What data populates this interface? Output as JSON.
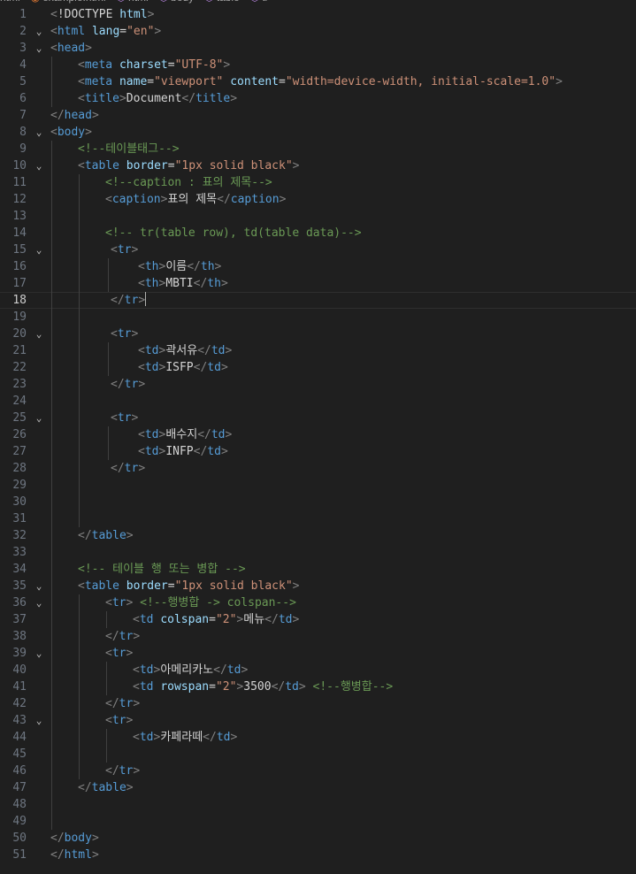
{
  "breadcrumb": [
    {
      "label": "html",
      "icon": ""
    },
    {
      "label": "example.html",
      "icon": "html-file-icon"
    },
    {
      "label": "html",
      "icon": "element-icon"
    },
    {
      "label": "body",
      "icon": "element-icon"
    },
    {
      "label": "table",
      "icon": "element-icon"
    },
    {
      "label": "tr",
      "icon": "element-icon"
    }
  ],
  "editor": {
    "current_line": 18,
    "colors": {
      "background": "#1f1f1f",
      "bracket": "#808080",
      "tag": "#569cd6",
      "attribute": "#9cdcfe",
      "string": "#ce9178",
      "comment": "#6a9955",
      "text": "#d4d4d4",
      "line_number": "#6e7681"
    },
    "lines": [
      {
        "n": "1",
        "fold": false,
        "indent": 0,
        "tokens": [
          [
            "b",
            "<"
          ],
          [
            "x",
            "!DOCTYPE "
          ],
          [
            "a",
            "html"
          ],
          [
            "b",
            ">"
          ]
        ]
      },
      {
        "n": "2",
        "fold": true,
        "indent": 0,
        "tokens": [
          [
            "b",
            "<"
          ],
          [
            "t",
            "html "
          ],
          [
            "a",
            "lang"
          ],
          [
            "x",
            "="
          ],
          [
            "s",
            "\"en\""
          ],
          [
            "b",
            ">"
          ]
        ]
      },
      {
        "n": "3",
        "fold": true,
        "indent": 0,
        "tokens": [
          [
            "b",
            "<"
          ],
          [
            "t",
            "head"
          ],
          [
            "b",
            ">"
          ]
        ]
      },
      {
        "n": "4",
        "fold": false,
        "indent": 1,
        "tokens": [
          [
            "b",
            "<"
          ],
          [
            "t",
            "meta "
          ],
          [
            "a",
            "charset"
          ],
          [
            "x",
            "="
          ],
          [
            "s",
            "\"UTF-8\""
          ],
          [
            "b",
            ">"
          ]
        ]
      },
      {
        "n": "5",
        "fold": false,
        "indent": 1,
        "tokens": [
          [
            "b",
            "<"
          ],
          [
            "t",
            "meta "
          ],
          [
            "a",
            "name"
          ],
          [
            "x",
            "="
          ],
          [
            "s",
            "\"viewport\""
          ],
          [
            "x",
            " "
          ],
          [
            "a",
            "content"
          ],
          [
            "x",
            "="
          ],
          [
            "s",
            "\"width=device-width, initial-scale=1.0\""
          ],
          [
            "b",
            ">"
          ]
        ]
      },
      {
        "n": "6",
        "fold": false,
        "indent": 1,
        "tokens": [
          [
            "b",
            "<"
          ],
          [
            "t",
            "title"
          ],
          [
            "b",
            ">"
          ],
          [
            "x",
            "Document"
          ],
          [
            "b",
            "</"
          ],
          [
            "t",
            "title"
          ],
          [
            "b",
            ">"
          ]
        ]
      },
      {
        "n": "7",
        "fold": false,
        "indent": 0,
        "tokens": [
          [
            "b",
            "</"
          ],
          [
            "t",
            "head"
          ],
          [
            "b",
            ">"
          ]
        ]
      },
      {
        "n": "8",
        "fold": true,
        "indent": 0,
        "tokens": [
          [
            "b",
            "<"
          ],
          [
            "t",
            "body"
          ],
          [
            "b",
            ">"
          ]
        ]
      },
      {
        "n": "9",
        "fold": false,
        "indent": 1,
        "tokens": [
          [
            "c",
            "<!--테이블태그-->"
          ]
        ]
      },
      {
        "n": "10",
        "fold": true,
        "indent": 1,
        "tokens": [
          [
            "b",
            "<"
          ],
          [
            "t",
            "table "
          ],
          [
            "a",
            "border"
          ],
          [
            "x",
            "="
          ],
          [
            "s",
            "\"1px solid black\""
          ],
          [
            "b",
            ">"
          ]
        ]
      },
      {
        "n": "11",
        "fold": false,
        "indent": 2,
        "tokens": [
          [
            "c",
            "<!--caption : 표의 제목-->"
          ]
        ]
      },
      {
        "n": "12",
        "fold": false,
        "indent": 2,
        "tokens": [
          [
            "b",
            "<"
          ],
          [
            "t",
            "caption"
          ],
          [
            "b",
            ">"
          ],
          [
            "x",
            "표의 제목"
          ],
          [
            "b",
            "</"
          ],
          [
            "t",
            "caption"
          ],
          [
            "b",
            ">"
          ]
        ]
      },
      {
        "n": "13",
        "fold": false,
        "indent": 2,
        "tokens": []
      },
      {
        "n": "14",
        "fold": false,
        "indent": 2,
        "tokens": [
          [
            "c",
            "<!-- tr(table row), td(table data)-->"
          ]
        ]
      },
      {
        "n": "15",
        "fold": true,
        "indent": 2,
        "extra": 2,
        "tokens": [
          [
            "b",
            "<"
          ],
          [
            "t",
            "tr"
          ],
          [
            "b",
            ">"
          ]
        ]
      },
      {
        "n": "16",
        "fold": false,
        "indent": 3,
        "extra": 2,
        "tokens": [
          [
            "b",
            "<"
          ],
          [
            "t",
            "th"
          ],
          [
            "b",
            ">"
          ],
          [
            "x",
            "이름"
          ],
          [
            "b",
            "</"
          ],
          [
            "t",
            "th"
          ],
          [
            "b",
            ">"
          ]
        ]
      },
      {
        "n": "17",
        "fold": false,
        "indent": 3,
        "extra": 2,
        "tokens": [
          [
            "b",
            "<"
          ],
          [
            "t",
            "th"
          ],
          [
            "b",
            ">"
          ],
          [
            "x",
            "MBTI"
          ],
          [
            "b",
            "</"
          ],
          [
            "t",
            "th"
          ],
          [
            "b",
            ">"
          ]
        ]
      },
      {
        "n": "18",
        "fold": false,
        "indent": 2,
        "extra": 2,
        "cursor": true,
        "tokens": [
          [
            "b",
            "</"
          ],
          [
            "t",
            "tr"
          ],
          [
            "b",
            ">"
          ]
        ]
      },
      {
        "n": "19",
        "fold": false,
        "indent": 2,
        "tokens": []
      },
      {
        "n": "20",
        "fold": true,
        "indent": 2,
        "extra": 2,
        "tokens": [
          [
            "b",
            "<"
          ],
          [
            "t",
            "tr"
          ],
          [
            "b",
            ">"
          ]
        ]
      },
      {
        "n": "21",
        "fold": false,
        "indent": 3,
        "extra": 2,
        "tokens": [
          [
            "b",
            "<"
          ],
          [
            "t",
            "td"
          ],
          [
            "b",
            ">"
          ],
          [
            "x",
            "곽서유"
          ],
          [
            "b",
            "</"
          ],
          [
            "t",
            "td"
          ],
          [
            "b",
            ">"
          ]
        ]
      },
      {
        "n": "22",
        "fold": false,
        "indent": 3,
        "extra": 2,
        "tokens": [
          [
            "b",
            "<"
          ],
          [
            "t",
            "td"
          ],
          [
            "b",
            ">"
          ],
          [
            "x",
            "ISFP"
          ],
          [
            "b",
            "</"
          ],
          [
            "t",
            "td"
          ],
          [
            "b",
            ">"
          ]
        ]
      },
      {
        "n": "23",
        "fold": false,
        "indent": 2,
        "extra": 2,
        "tokens": [
          [
            "b",
            "</"
          ],
          [
            "t",
            "tr"
          ],
          [
            "b",
            ">"
          ]
        ]
      },
      {
        "n": "24",
        "fold": false,
        "indent": 2,
        "tokens": []
      },
      {
        "n": "25",
        "fold": true,
        "indent": 2,
        "extra": 2,
        "tokens": [
          [
            "b",
            "<"
          ],
          [
            "t",
            "tr"
          ],
          [
            "b",
            ">"
          ]
        ]
      },
      {
        "n": "26",
        "fold": false,
        "indent": 3,
        "extra": 2,
        "tokens": [
          [
            "b",
            "<"
          ],
          [
            "t",
            "td"
          ],
          [
            "b",
            ">"
          ],
          [
            "x",
            "배수지"
          ],
          [
            "b",
            "</"
          ],
          [
            "t",
            "td"
          ],
          [
            "b",
            ">"
          ]
        ]
      },
      {
        "n": "27",
        "fold": false,
        "indent": 3,
        "extra": 2,
        "tokens": [
          [
            "b",
            "<"
          ],
          [
            "t",
            "td"
          ],
          [
            "b",
            ">"
          ],
          [
            "x",
            "INFP"
          ],
          [
            "b",
            "</"
          ],
          [
            "t",
            "td"
          ],
          [
            "b",
            ">"
          ]
        ]
      },
      {
        "n": "28",
        "fold": false,
        "indent": 2,
        "extra": 2,
        "tokens": [
          [
            "b",
            "</"
          ],
          [
            "t",
            "tr"
          ],
          [
            "b",
            ">"
          ]
        ]
      },
      {
        "n": "29",
        "fold": false,
        "indent": 2,
        "tokens": []
      },
      {
        "n": "30",
        "fold": false,
        "indent": 2,
        "tokens": []
      },
      {
        "n": "31",
        "fold": false,
        "indent": 2,
        "tokens": []
      },
      {
        "n": "32",
        "fold": false,
        "indent": 1,
        "tokens": [
          [
            "b",
            "</"
          ],
          [
            "t",
            "table"
          ],
          [
            "b",
            ">"
          ]
        ]
      },
      {
        "n": "33",
        "fold": false,
        "indent": 1,
        "tokens": []
      },
      {
        "n": "34",
        "fold": false,
        "indent": 1,
        "tokens": [
          [
            "c",
            "<!-- 테이블 행 또는 병합 -->"
          ]
        ]
      },
      {
        "n": "35",
        "fold": true,
        "indent": 1,
        "tokens": [
          [
            "b",
            "<"
          ],
          [
            "t",
            "table "
          ],
          [
            "a",
            "border"
          ],
          [
            "x",
            "="
          ],
          [
            "s",
            "\"1px solid black\""
          ],
          [
            "b",
            ">"
          ]
        ]
      },
      {
        "n": "36",
        "fold": true,
        "indent": 2,
        "tokens": [
          [
            "b",
            "<"
          ],
          [
            "t",
            "tr"
          ],
          [
            "b",
            ">"
          ],
          [
            "x",
            " "
          ],
          [
            "c",
            "<!--행병합 -> colspan-->"
          ]
        ]
      },
      {
        "n": "37",
        "fold": false,
        "indent": 3,
        "tokens": [
          [
            "b",
            "<"
          ],
          [
            "t",
            "td "
          ],
          [
            "a",
            "colspan"
          ],
          [
            "x",
            "="
          ],
          [
            "s",
            "\"2\""
          ],
          [
            "b",
            ">"
          ],
          [
            "x",
            "메뉴"
          ],
          [
            "b",
            "</"
          ],
          [
            "t",
            "td"
          ],
          [
            "b",
            ">"
          ]
        ]
      },
      {
        "n": "38",
        "fold": false,
        "indent": 2,
        "tokens": [
          [
            "b",
            "</"
          ],
          [
            "t",
            "tr"
          ],
          [
            "b",
            ">"
          ]
        ]
      },
      {
        "n": "39",
        "fold": true,
        "indent": 2,
        "tokens": [
          [
            "b",
            "<"
          ],
          [
            "t",
            "tr"
          ],
          [
            "b",
            ">"
          ]
        ]
      },
      {
        "n": "40",
        "fold": false,
        "indent": 3,
        "tokens": [
          [
            "b",
            "<"
          ],
          [
            "t",
            "td"
          ],
          [
            "b",
            ">"
          ],
          [
            "x",
            "아메리카노"
          ],
          [
            "b",
            "</"
          ],
          [
            "t",
            "td"
          ],
          [
            "b",
            ">"
          ]
        ]
      },
      {
        "n": "41",
        "fold": false,
        "indent": 3,
        "tokens": [
          [
            "b",
            "<"
          ],
          [
            "t",
            "td "
          ],
          [
            "a",
            "rowspan"
          ],
          [
            "x",
            "="
          ],
          [
            "s",
            "\"2\""
          ],
          [
            "b",
            ">"
          ],
          [
            "x",
            "3500"
          ],
          [
            "b",
            "</"
          ],
          [
            "t",
            "td"
          ],
          [
            "b",
            ">"
          ],
          [
            "x",
            " "
          ],
          [
            "c",
            "<!--행병합-->"
          ]
        ]
      },
      {
        "n": "42",
        "fold": false,
        "indent": 2,
        "tokens": [
          [
            "b",
            "</"
          ],
          [
            "t",
            "tr"
          ],
          [
            "b",
            ">"
          ]
        ]
      },
      {
        "n": "43",
        "fold": true,
        "indent": 2,
        "tokens": [
          [
            "b",
            "<"
          ],
          [
            "t",
            "tr"
          ],
          [
            "b",
            ">"
          ]
        ]
      },
      {
        "n": "44",
        "fold": false,
        "indent": 3,
        "tokens": [
          [
            "b",
            "<"
          ],
          [
            "t",
            "td"
          ],
          [
            "b",
            ">"
          ],
          [
            "x",
            "카페라떼"
          ],
          [
            "b",
            "</"
          ],
          [
            "t",
            "td"
          ],
          [
            "b",
            ">"
          ]
        ]
      },
      {
        "n": "45",
        "fold": false,
        "indent": 3,
        "tokens": []
      },
      {
        "n": "46",
        "fold": false,
        "indent": 2,
        "tokens": [
          [
            "b",
            "</"
          ],
          [
            "t",
            "tr"
          ],
          [
            "b",
            ">"
          ]
        ]
      },
      {
        "n": "47",
        "fold": false,
        "indent": 1,
        "tokens": [
          [
            "b",
            "</"
          ],
          [
            "t",
            "table"
          ],
          [
            "b",
            ">"
          ]
        ]
      },
      {
        "n": "48",
        "fold": false,
        "indent": 1,
        "tokens": []
      },
      {
        "n": "49",
        "fold": false,
        "indent": 1,
        "tokens": []
      },
      {
        "n": "50",
        "fold": false,
        "indent": 0,
        "tokens": [
          [
            "b",
            "</"
          ],
          [
            "t",
            "body"
          ],
          [
            "b",
            ">"
          ]
        ]
      },
      {
        "n": "51",
        "fold": false,
        "indent": 0,
        "tokens": [
          [
            "b",
            "</"
          ],
          [
            "t",
            "html"
          ],
          [
            "b",
            ">"
          ]
        ]
      }
    ]
  }
}
